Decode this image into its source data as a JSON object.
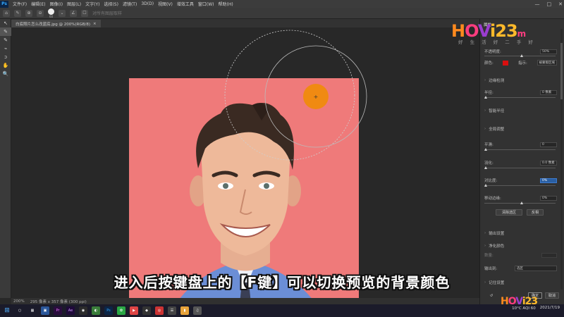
{
  "app": {
    "logo": "Ps",
    "menu": [
      "文件(F)",
      "编辑(E)",
      "图像(I)",
      "图层(L)",
      "文字(Y)",
      "选择(S)",
      "滤镜(T)",
      "3D(D)",
      "视图(V)",
      "增效工具",
      "窗口(W)",
      "帮助(H)"
    ],
    "window_controls": [
      "—",
      "□",
      "✕"
    ]
  },
  "options_bar": {
    "brush_size": "60",
    "search_hint": "对所有图层取样"
  },
  "document_tab": {
    "title": "白底照片怎么改蓝底.jpg @ 200%(RGB/8)",
    "close": "×"
  },
  "tools": [
    "↖",
    "✎",
    "✎",
    "✋",
    "🔍"
  ],
  "statusbar": {
    "zoom": "200%",
    "doc_info": "295 像素 x 357 像素 (300 ppi)"
  },
  "caption": "进入后按键盘上的【F键】可以切换预览的背景颜色",
  "panel": {
    "title": "属性",
    "opacity_label": "不透明度:",
    "opacity_value": "50%",
    "color_label": "颜色:",
    "color_hex": "#d90f0f",
    "indicate_label": "指示:",
    "indicate_value": "被蒙版区域",
    "edge_detection": "边缘检测",
    "radius_label": "半径:",
    "radius_value": "0 像素",
    "smart_radius": "智能半径",
    "global_refine": "全局调整",
    "smooth_label": "平滑:",
    "smooth_value": "0",
    "feather_label": "羽化:",
    "feather_value": "0.0 像素",
    "contrast_label": "对比度:",
    "contrast_value": "0%",
    "shift_edge_label": "移动边缘:",
    "shift_edge_value": "0%",
    "clear_selection_btn": "清除选区",
    "invert_btn": "反相",
    "output_settings": "输出设置",
    "decontaminate": "净化颜色",
    "amount_label": "数量:",
    "output_to_label": "输出到:",
    "output_to_value": "选区",
    "remember_settings": "记住设置",
    "ok_btn": "确定",
    "cancel_btn": "取消",
    "reset_icon": "↺"
  },
  "watermark": {
    "brand_1": "H",
    "brand_2": "O",
    "brand_3": "V",
    "brand_4": "i23",
    "suffix": "m",
    "sub": "好 生 活 好 二 手 好"
  },
  "taskbar": {
    "apps": [
      "⊞",
      "○",
      "▦",
      "▣",
      "Pr",
      "Ae",
      "◉",
      "◐",
      "Ps",
      "✿",
      "▶",
      "◆",
      "◎",
      "☰",
      "▮",
      "♫"
    ],
    "weather": "10°C AQI 60",
    "time": "",
    "date": "2021/7/19"
  }
}
